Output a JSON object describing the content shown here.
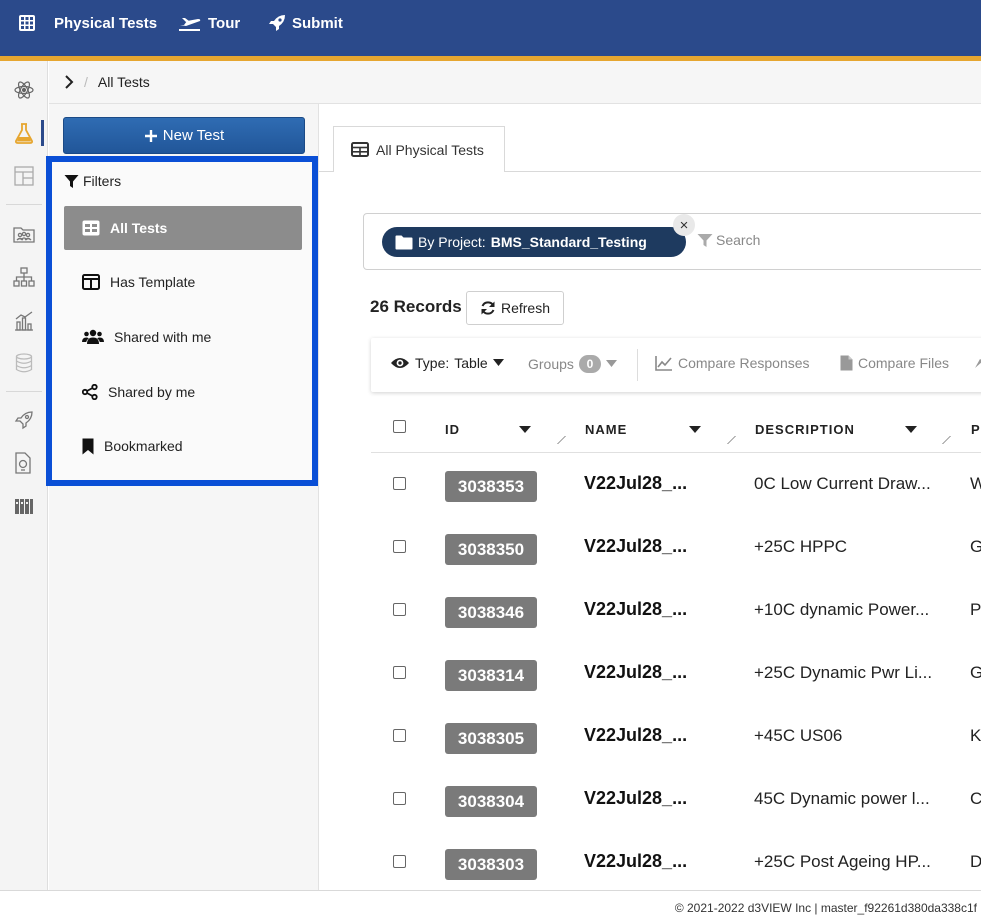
{
  "topbar": {
    "app_title": "Physical Tests",
    "tour_label": "Tour",
    "submit_label": "Submit",
    "bg_color": "#2b4a8b",
    "stripe_color": "#e6a630"
  },
  "breadcrumb": {
    "current": "All Tests"
  },
  "left_panel": {
    "new_test_label": "New Test",
    "filters_title": "Filters",
    "filters": [
      {
        "label": "All Tests",
        "icon": "table-icon",
        "active": true
      },
      {
        "label": "Has Template",
        "icon": "columns-icon",
        "active": false
      },
      {
        "label": "Shared with me",
        "icon": "users-icon",
        "active": false
      },
      {
        "label": "Shared by me",
        "icon": "share-icon",
        "active": false
      },
      {
        "label": "Bookmarked",
        "icon": "bookmark-icon",
        "active": false
      }
    ],
    "highlight_color": "#0a4fd6"
  },
  "main": {
    "tab_label": "All Physical Tests",
    "search": {
      "chip_prefix": "By Project:",
      "chip_value": "BMS_Standard_Testing",
      "chip_close": "×",
      "placeholder": "Search"
    },
    "records_label": "26 Records",
    "refresh_label": "Refresh",
    "toolbar": {
      "type_prefix": "Type:",
      "type_value": "Table",
      "groups_label": "Groups",
      "groups_count": "0",
      "compare_responses": "Compare Responses",
      "compare_files": "Compare Files"
    },
    "table": {
      "columns": [
        "ID",
        "NAME",
        "DESCRIPTION",
        "P"
      ],
      "rows": [
        {
          "id": "3038353",
          "name": "V22Jul28_...",
          "description": "0C Low Current Draw...",
          "extra": "W"
        },
        {
          "id": "3038350",
          "name": "V22Jul28_...",
          "description": "+25C HPPC",
          "extra": "G"
        },
        {
          "id": "3038346",
          "name": "V22Jul28_...",
          "description": "+10C dynamic Power...",
          "extra": "P"
        },
        {
          "id": "3038314",
          "name": "V22Jul28_...",
          "description": "+25C Dynamic Pwr Li...",
          "extra": "G"
        },
        {
          "id": "3038305",
          "name": "V22Jul28_...",
          "description": "+45C US06",
          "extra": "K"
        },
        {
          "id": "3038304",
          "name": "V22Jul28_...",
          "description": "45C Dynamic power l...",
          "extra": "C"
        },
        {
          "id": "3038303",
          "name": "V22Jul28_...",
          "description": "+25C Post Ageing HP...",
          "extra": "D"
        }
      ]
    }
  },
  "footer": {
    "text": "© 2021-2022 d3VIEW Inc | master_f92261d380da338c1f"
  }
}
